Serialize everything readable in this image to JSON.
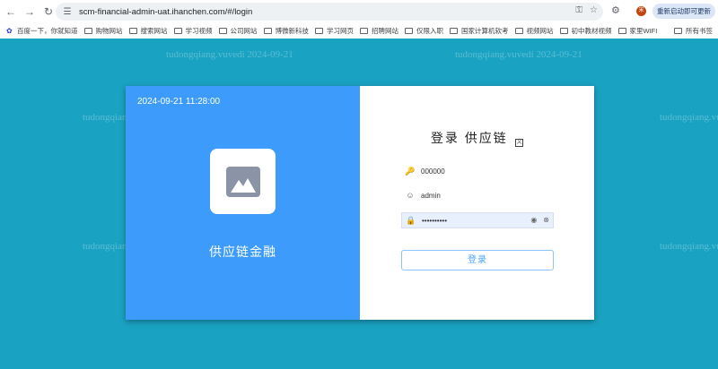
{
  "browser": {
    "url": "scm-financial-admin-uat.ihanchen.com/#/login",
    "update_button": "重新启动即可更新",
    "avatar_letter": "宋"
  },
  "bookmarks": {
    "items": [
      {
        "label": "百度一下，你就知道",
        "icon": "baidu-paw-icon"
      },
      {
        "label": "购物网站",
        "icon": "folder-icon"
      },
      {
        "label": "搜索网站",
        "icon": "folder-icon"
      },
      {
        "label": "学习视频",
        "icon": "folder-icon"
      },
      {
        "label": "公司网站",
        "icon": "folder-icon"
      },
      {
        "label": "博微新科技",
        "icon": "folder-icon"
      },
      {
        "label": "学习网页",
        "icon": "folder-icon"
      },
      {
        "label": "招聘网站",
        "icon": "folder-icon"
      },
      {
        "label": "仅限入职",
        "icon": "folder-icon"
      },
      {
        "label": "国家计算机软考",
        "icon": "folder-icon"
      },
      {
        "label": "视频网站",
        "icon": "folder-icon"
      },
      {
        "label": "初中教材视频",
        "icon": "folder-icon"
      },
      {
        "label": "家里WIFI",
        "icon": "folder-icon"
      }
    ],
    "all_bookmarks": "所有书签"
  },
  "watermark": {
    "text": "tudongqiang.vuvedi 2024-09-21"
  },
  "login": {
    "datetime": "2024-09-21 11:28:00",
    "brand": "供应链金融",
    "title": "登录 供应链",
    "tenant_value": "000000",
    "username_value": "admin",
    "password_value": "••••••••••",
    "submit_label": "登录"
  },
  "colors": {
    "background": "#1aa2c2",
    "left_panel": "#3d9cfb",
    "button_text": "#4aa3ff"
  }
}
